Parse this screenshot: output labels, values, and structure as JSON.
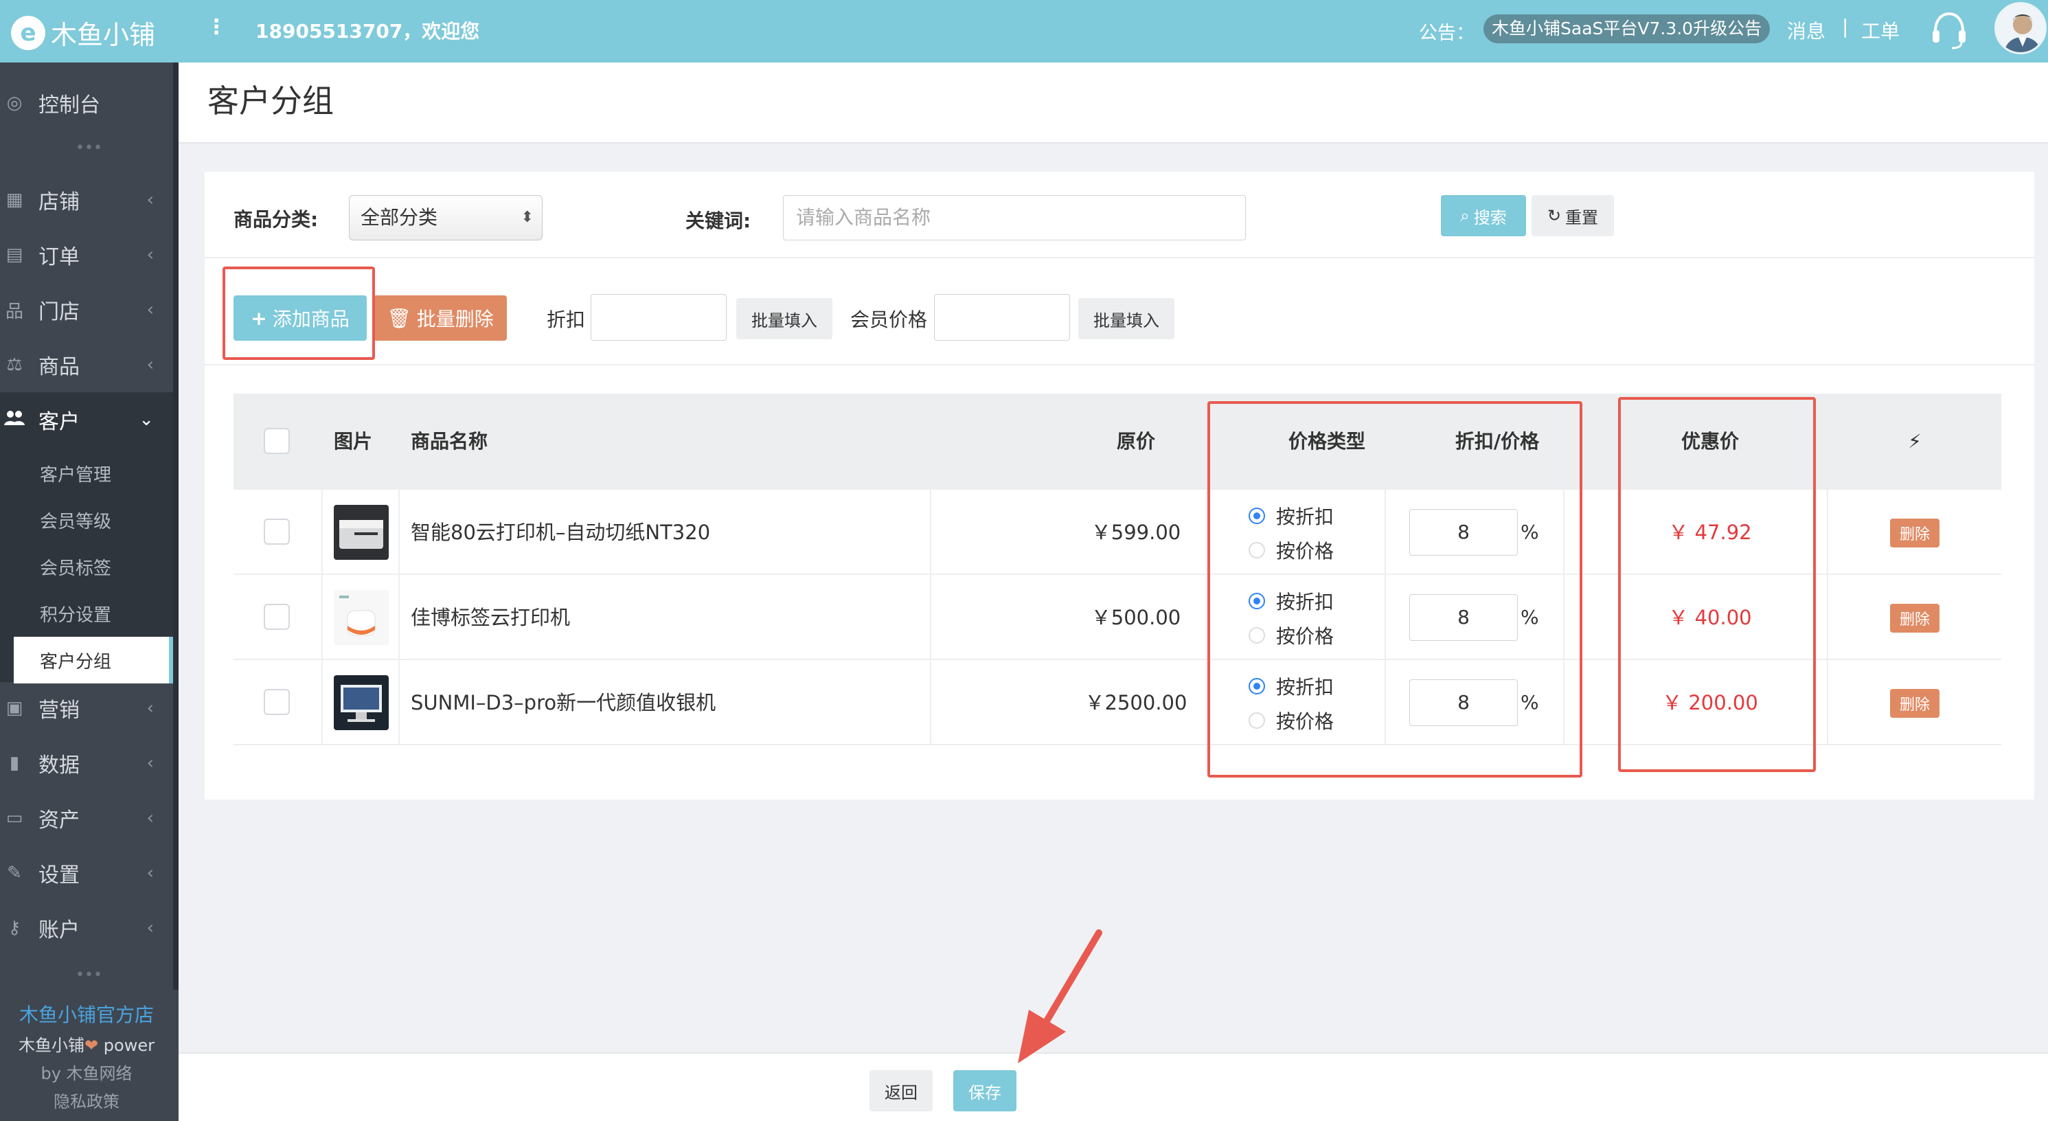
{
  "topbar": {
    "logo_glyph": "e",
    "brand": "木鱼小铺",
    "menu_icon": "vertical-dots-icon",
    "welcome": "18905513707，欢迎您",
    "notice_label": "公告：",
    "notice_text": "木鱼小铺SaaS平台V7.3.0升级公告",
    "messages": "消息",
    "separator": "|",
    "ticket": "工单"
  },
  "sidebar": {
    "items": [
      {
        "label": "控制台",
        "icon": "dashboard-icon",
        "glyph": "◎"
      },
      {
        "label": "店铺",
        "icon": "store-icon",
        "glyph": "▦"
      },
      {
        "label": "订单",
        "icon": "order-icon",
        "glyph": "▤"
      },
      {
        "label": "门店",
        "icon": "org-icon",
        "glyph": "品"
      },
      {
        "label": "商品",
        "icon": "scale-icon",
        "glyph": "⚖"
      },
      {
        "label": "客户",
        "icon": "users-icon",
        "glyph": "👥"
      },
      {
        "label": "营销",
        "icon": "marketing-icon",
        "glyph": "▣"
      },
      {
        "label": "数据",
        "icon": "chart-icon",
        "glyph": "▮"
      },
      {
        "label": "资产",
        "icon": "money-icon",
        "glyph": "▭"
      },
      {
        "label": "设置",
        "icon": "wrench-icon",
        "glyph": "✎"
      },
      {
        "label": "账户",
        "icon": "key-icon",
        "glyph": "⚷"
      }
    ],
    "chev_right": "‹",
    "chev_down": "⌄",
    "sub_items": [
      "客户管理",
      "会员等级",
      "会员标签",
      "积分设置",
      "客户分组"
    ],
    "ellipsis": "•••",
    "footer": {
      "shop": "木鱼小铺官方店",
      "power_pre": "木鱼小铺",
      "heart": "❤",
      "power_post": " power",
      "by": "by 木鱼网络",
      "privacy": "隐私政策"
    }
  },
  "page": {
    "title": "客户分组"
  },
  "filter": {
    "category_label": "商品分类:",
    "category_value": "全部分类",
    "keyword_label": "关键词:",
    "keyword_placeholder": "请输入商品名称",
    "search": "搜索",
    "reset": "重置"
  },
  "toolbar": {
    "add": "添加商品",
    "batch_delete": "批量删除",
    "discount_label": "折扣",
    "batch_fill": "批量填入",
    "member_price_label": "会员价格"
  },
  "table": {
    "headers": {
      "image": "图片",
      "name": "商品名称",
      "original_price": "原价",
      "price_type": "价格类型",
      "discount_price": "折扣/价格",
      "promo_price": "优惠价",
      "action_icon": "⚡"
    },
    "rows": [
      {
        "name": "智能80云打印机–自动切纸NT320",
        "price": "￥599.00",
        "opt1": "按折扣",
        "opt2": "按价格",
        "value": "8",
        "unit": "%",
        "promo": "￥ 47.92",
        "delete": "删除"
      },
      {
        "name": "佳博标签云打印机",
        "price": "￥500.00",
        "opt1": "按折扣",
        "opt2": "按价格",
        "value": "8",
        "unit": "%",
        "promo": "￥ 40.00",
        "delete": "删除"
      },
      {
        "name": "SUNMI–D3–pro新一代颜值收银机",
        "price": "￥2500.00",
        "opt1": "按折扣",
        "opt2": "按价格",
        "value": "8",
        "unit": "%",
        "promo": "￥ 200.00",
        "delete": "删除"
      }
    ]
  },
  "footer": {
    "back": "返回",
    "save": "保存"
  },
  "colors": {
    "primary": "#7fcadb",
    "danger_btn": "#e08a63",
    "price_red": "#e4393c",
    "highlight": "#e85a4f",
    "sidebar": "#3f4650"
  }
}
